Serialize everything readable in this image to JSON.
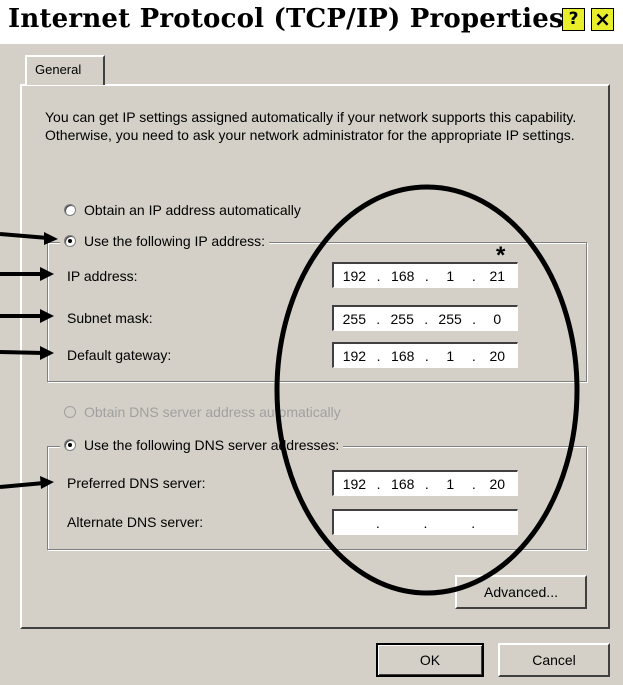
{
  "window": {
    "title": "Internet Protocol (TCP/IP) Properties",
    "help_label": "?",
    "close_label": "×"
  },
  "tabs": [
    {
      "label": "General"
    }
  ],
  "intro": "You can get IP settings assigned automatically if your network supports this capability. Otherwise, you need to ask your network administrator for the appropriate IP settings.",
  "ip_options": {
    "auto_label": "Obtain an IP address automatically",
    "manual_label": "Use the following IP address:",
    "selected": "manual"
  },
  "ip_fields": [
    {
      "label": "IP address:",
      "octets": [
        "192",
        "168",
        "1",
        "21"
      ]
    },
    {
      "label": "Subnet mask:",
      "octets": [
        "255",
        "255",
        "255",
        "0"
      ]
    },
    {
      "label": "Default gateway:",
      "octets": [
        "192",
        "168",
        "1",
        "20"
      ]
    }
  ],
  "dns_options": {
    "auto_label": "Obtain DNS server address automatically",
    "manual_label": "Use the following DNS server addresses:",
    "selected": "manual"
  },
  "dns_fields": [
    {
      "label": "Preferred DNS server:",
      "octets": [
        "192",
        "168",
        "1",
        "20"
      ]
    },
    {
      "label": "Alternate DNS server:",
      "octets": [
        "",
        "",
        "",
        ""
      ]
    }
  ],
  "buttons": {
    "advanced": "Advanced...",
    "ok": "OK",
    "cancel": "Cancel"
  },
  "annotation": {
    "asterisk": "*"
  }
}
